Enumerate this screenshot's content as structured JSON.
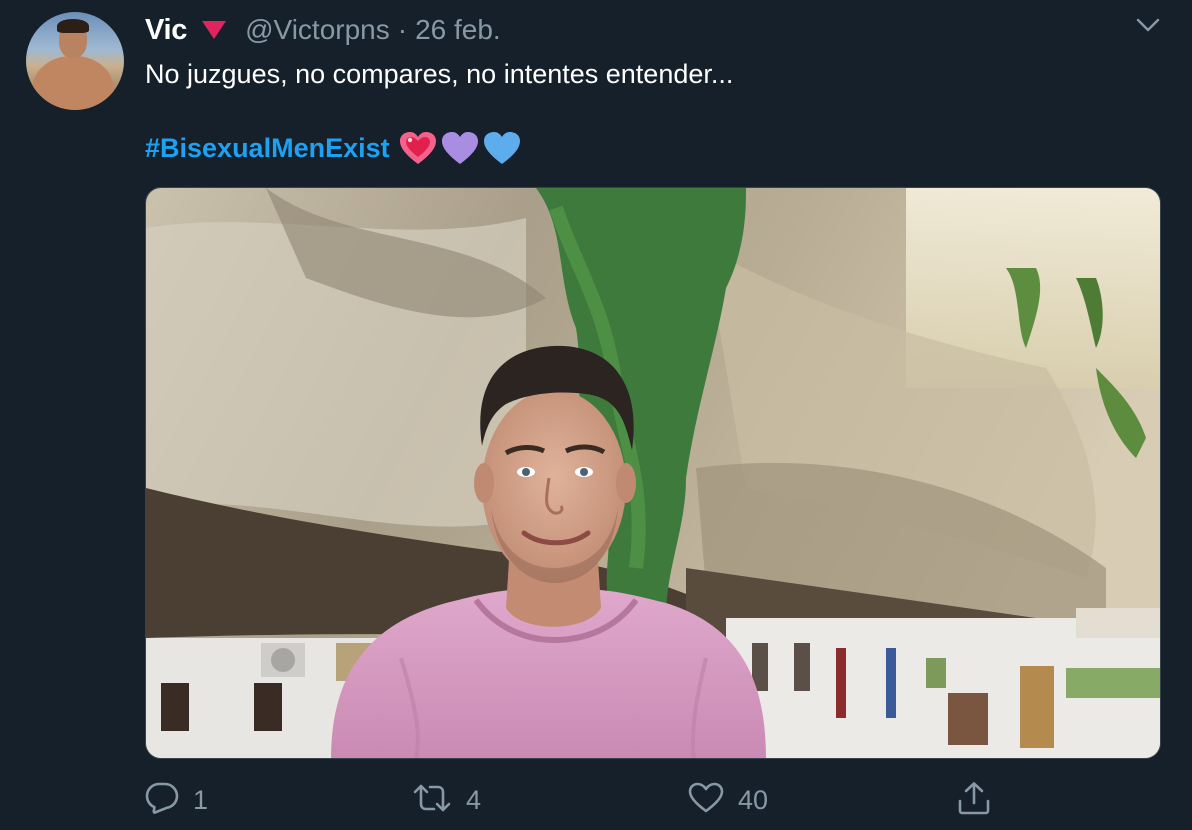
{
  "tweet": {
    "author_name": "Vic",
    "handle": "@Victorpns",
    "separator": "·",
    "date": "26 feb.",
    "text": "No juzgues, no compares, no intentes entender...",
    "hashtag": "#BisexualMenExist",
    "emojis": [
      "sparkling-heart",
      "purple-heart",
      "blue-heart"
    ],
    "media_alt": "Photo of a man in a pink t-shirt in front of a rocky cliff overhanging white houses"
  },
  "actions": {
    "reply_count": "1",
    "retweet_count": "4",
    "like_count": "40"
  },
  "icons": {
    "verified_marker": "triangle-down-icon",
    "menu": "chevron-down-icon",
    "reply": "reply-icon",
    "retweet": "retweet-icon",
    "like": "heart-icon",
    "share": "share-icon"
  },
  "colors": {
    "background": "#15202b",
    "secondary_text": "#8899a6",
    "link": "#1da1f2",
    "marker": "#e0245e"
  }
}
